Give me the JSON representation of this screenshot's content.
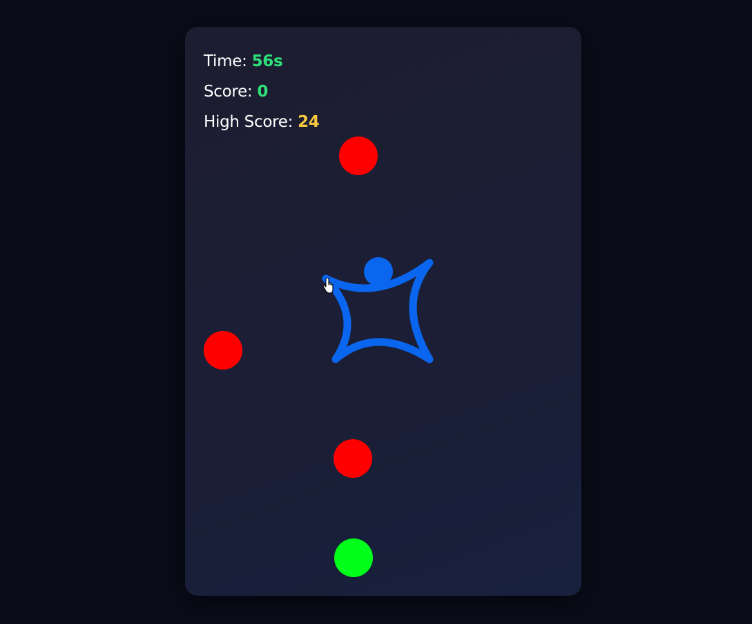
{
  "hud": {
    "time_label": "Time:",
    "time_value": "56s",
    "score_label": "Score:",
    "score_value": "0",
    "high_score_label": "High Score:",
    "high_score_value": "24"
  },
  "colors": {
    "enemy": "#ff0000",
    "goal": "#00ff1a",
    "player": "#0a66ee",
    "value_green": "#2ee07a",
    "value_yellow": "#f5c842"
  },
  "entities": {
    "enemies": [
      "red-ball",
      "red-ball",
      "red-ball"
    ],
    "goal": "green-ball",
    "player": "blue-star-figure",
    "cursor": "hand-pointer-icon"
  }
}
